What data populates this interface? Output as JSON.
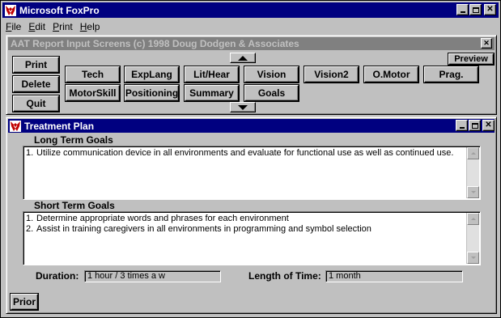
{
  "app": {
    "title": "Microsoft FoxPro",
    "menu": [
      {
        "label": "ile",
        "accel": "F"
      },
      {
        "label": "dit",
        "accel": "E"
      },
      {
        "label": "rint",
        "accel": "P"
      },
      {
        "label": "elp",
        "accel": "H"
      }
    ]
  },
  "report_window": {
    "title": "AAT Report Input Screens (c) 1998 Doug Dodgen & Associates",
    "buttons": {
      "print": "Print",
      "delete": "Delete",
      "quit": "Quit",
      "preview": "Preview",
      "tech": "Tech",
      "explang": "ExpLang",
      "lithear": "Lit/Hear",
      "vision": "Vision",
      "vision2": "Vision2",
      "omotor": "O.Motor",
      "prag": "Prag.",
      "motorskill": "MotorSkill",
      "positioning": "Positioning",
      "summary": "Summary",
      "goals": "Goals"
    }
  },
  "treatment_window": {
    "title": "Treatment Plan",
    "long_term": {
      "label": "Long Term Goals",
      "items": [
        {
          "num": "1.",
          "text": "Utilize communication device in all environments and evaluate for functional use as well as continued use."
        }
      ]
    },
    "short_term": {
      "label": "Short Term Goals",
      "items": [
        {
          "num": "1.",
          "text": "Determine appropriate words and phrases for each environment"
        },
        {
          "num": "2.",
          "text": "Assist in training caregivers in all environments in programming and symbol selection"
        }
      ]
    },
    "duration": {
      "label": "Duration:",
      "value": "1 hour / 3 times a w"
    },
    "length": {
      "label": "Length of Time:",
      "value": "1 month"
    },
    "prior_button": "Prior"
  },
  "colors": {
    "active_title": "#000080",
    "inactive_title": "#808080",
    "face": "#c0c0c0"
  }
}
